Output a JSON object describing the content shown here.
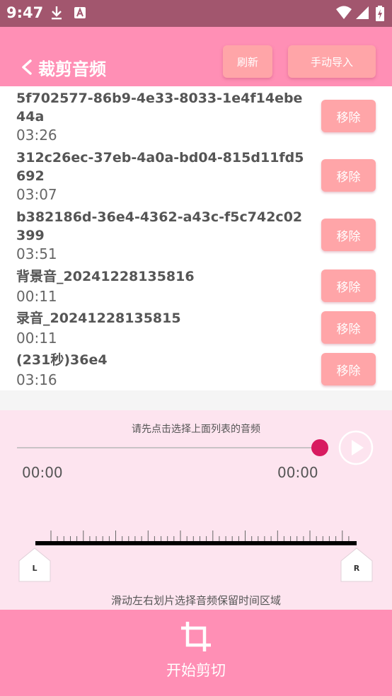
{
  "status_bar": {
    "time": "9:47",
    "icons": [
      "download-icon",
      "text-a-icon",
      "wifi-icon",
      "signal-icon",
      "battery-charging-icon"
    ]
  },
  "header": {
    "title": "裁剪音频",
    "refresh_label": "刷新",
    "import_label": "手动导入",
    "background_color": "#ff8fb5",
    "button_color": "#ffa5a8"
  },
  "list": {
    "remove_label": "移除",
    "items": [
      {
        "name": "5f702577-86b9-4e33-8033-1e4f14ebe44a",
        "duration": "03:26"
      },
      {
        "name": "312c26ec-37eb-4a0a-bd04-815d11fd5692",
        "duration": "03:07"
      },
      {
        "name": "b382186d-36e4-4362-a43c-f5c742c02399",
        "duration": "03:51"
      },
      {
        "name": "背景音_20241228135816",
        "duration": "00:11"
      },
      {
        "name": "录音_20241228135815",
        "duration": "00:11"
      },
      {
        "name": "(231秒)36e4",
        "duration": "03:16"
      }
    ]
  },
  "player": {
    "hint": "请先点击选择上面列表的音频",
    "current_time": "00:00",
    "total_time": "00:00",
    "progress": 1.0,
    "accent_color": "#d81b60",
    "left_handle": "L",
    "right_handle": "R",
    "cut_hint": "滑动左右划片选择音频保留时间区域"
  },
  "action": {
    "start_label": "开始剪切",
    "icon": "crop-icon"
  }
}
